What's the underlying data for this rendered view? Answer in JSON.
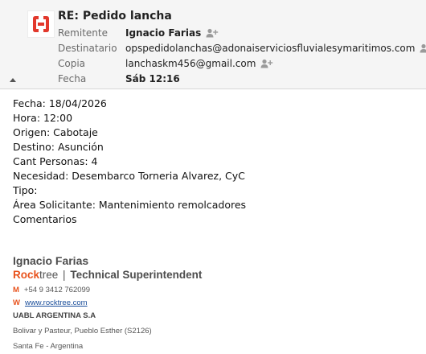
{
  "message": {
    "subject": "RE: Pedido lancha",
    "fields": [
      {
        "label": "Remitente",
        "value": "Ignacio Farias"
      },
      {
        "label": "Destinatario",
        "value": "opspedidolanchas@adonaiserviciosfluvialesymaritimos.com"
      },
      {
        "label": "Copia",
        "value": "lanchaskm456@gmail.com"
      },
      {
        "label": "Fecha",
        "value": "Sáb 12:16"
      }
    ]
  },
  "body": {
    "lines": [
      "Fecha: 18/04/2026",
      "Hora: 12:00",
      "Origen: Cabotaje",
      "Destino: Asunción",
      "Cant Personas: 4",
      "Necesidad: Desembarco Torneria Alvarez, CyC",
      "Tipo:",
      "Área Solicitante: Mantenimiento remolcadores",
      "Comentarios"
    ]
  },
  "signature": {
    "name": "Ignacio Farias",
    "company_rock": "Rock",
    "company_tree": "tree",
    "separator": "|",
    "title": "Technical Superintendent",
    "phone_tag": "M",
    "phone": "+54 9 3412 762099",
    "web_tag": "W",
    "web": "www.rocktree.com",
    "org": "UABL ARGENTINA S.A",
    "address1": "Bolivar y Pasteur, Pueblo Esther (S2126)",
    "address2": "Santa Fe - Argentina"
  },
  "colors": {
    "accent": "#e8521c",
    "logo_red": "#e2382c",
    "link": "#1a4e9a"
  },
  "icons": {
    "logo": "app-logo-icon",
    "add_contact": "add-contact-icon",
    "collapse": "collapse-caret-icon"
  }
}
